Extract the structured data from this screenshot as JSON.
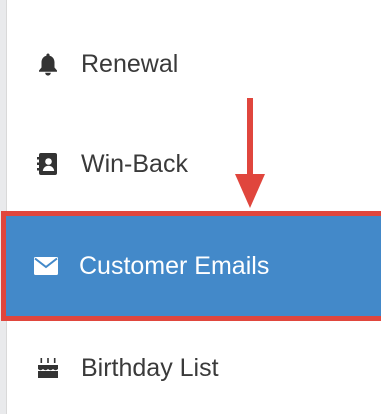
{
  "menu": {
    "items": [
      {
        "id": "renewal",
        "label": "Renewal",
        "icon": "bell-icon",
        "active": false
      },
      {
        "id": "win-back",
        "label": "Win-Back",
        "icon": "contact-book-icon",
        "active": false
      },
      {
        "id": "customer-emails",
        "label": "Customer Emails",
        "icon": "envelope-icon",
        "active": true
      },
      {
        "id": "birthday-list",
        "label": "Birthday List",
        "icon": "birthday-cake-icon",
        "active": false
      }
    ]
  },
  "colors": {
    "active_background": "#4389c9",
    "highlight_border": "#e0463d",
    "arrow": "#e0463d",
    "text": "#3a3a3a",
    "active_text": "#ffffff"
  }
}
